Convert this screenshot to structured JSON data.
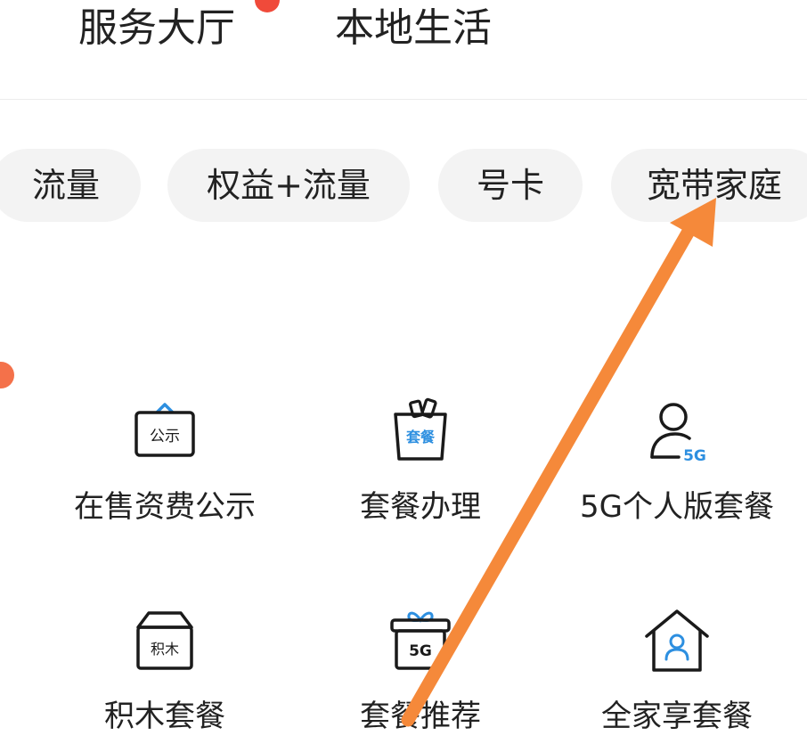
{
  "top_tabs": [
    {
      "label": "服务大厅"
    },
    {
      "label": "本地生活"
    }
  ],
  "categories": [
    {
      "label": "流量"
    },
    {
      "label": "权益+流量"
    },
    {
      "label": "号卡"
    },
    {
      "label": "宽带家庭"
    }
  ],
  "services": [
    {
      "label": "在售资费公示",
      "icon": "notice-board-icon",
      "icon_text": "公示"
    },
    {
      "label": "套餐办理",
      "icon": "shopping-bag-icon",
      "icon_text": "套餐"
    },
    {
      "label": "5G个人版套餐",
      "icon": "person-5g-icon",
      "icon_text": "5G"
    },
    {
      "label": "积木套餐",
      "icon": "box-icon",
      "icon_text": "积木"
    },
    {
      "label": "套餐推荐",
      "icon": "gift-5g-icon",
      "icon_text": "5G"
    },
    {
      "label": "全家享套餐",
      "icon": "home-person-icon"
    }
  ],
  "colors": {
    "accent_blue": "#2d8fe0",
    "annotation_arrow": "#f5893a",
    "notification_dot": "#f04a3a"
  }
}
